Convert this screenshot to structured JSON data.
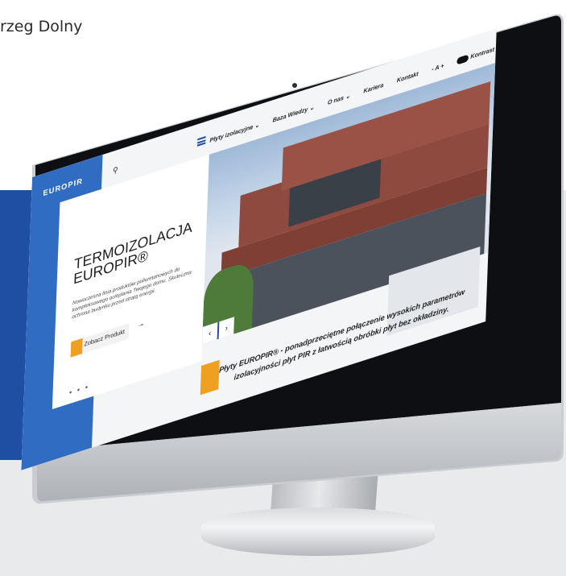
{
  "caption": "rzeg Dolny",
  "site": {
    "logo": "EUROPIR",
    "search_icon": "search-icon",
    "nav": {
      "items": [
        {
          "label": "Płyty izolacyjne",
          "caret": "⌄"
        },
        {
          "label": "Baza Wiedzy",
          "caret": "⌄"
        },
        {
          "label": "O nas",
          "caret": "⌄"
        },
        {
          "label": "Kariera",
          "caret": ""
        },
        {
          "label": "Kontakt",
          "caret": ""
        }
      ],
      "font_size_label": "- A +",
      "contrast_label": "Kontrast"
    },
    "hero": {
      "title_line1": "TERMOIZOLACJA",
      "title_line2": "EUROPIR®",
      "description": "Nowoczesna linia produktów poliuretanowych do kompleksowego ocieplania Twojego domu. Skuteczna ochrona budynku przed stratą energii.",
      "cta_label": "Zobacz Produkt",
      "cta_arrow": "→",
      "dots": "• • •",
      "prev": "‹",
      "next": "›"
    },
    "tagline_line1": "Płyty EUROPIR® - ponadprzeciętne połączenie wysokich parametrów",
    "tagline_line2": "izolacyjności płyt PIR z łatwością obróbki płyt bez okładziny.",
    "colors": {
      "brand_blue": "#1e4fa3",
      "accent_orange": "#f0a020"
    }
  }
}
